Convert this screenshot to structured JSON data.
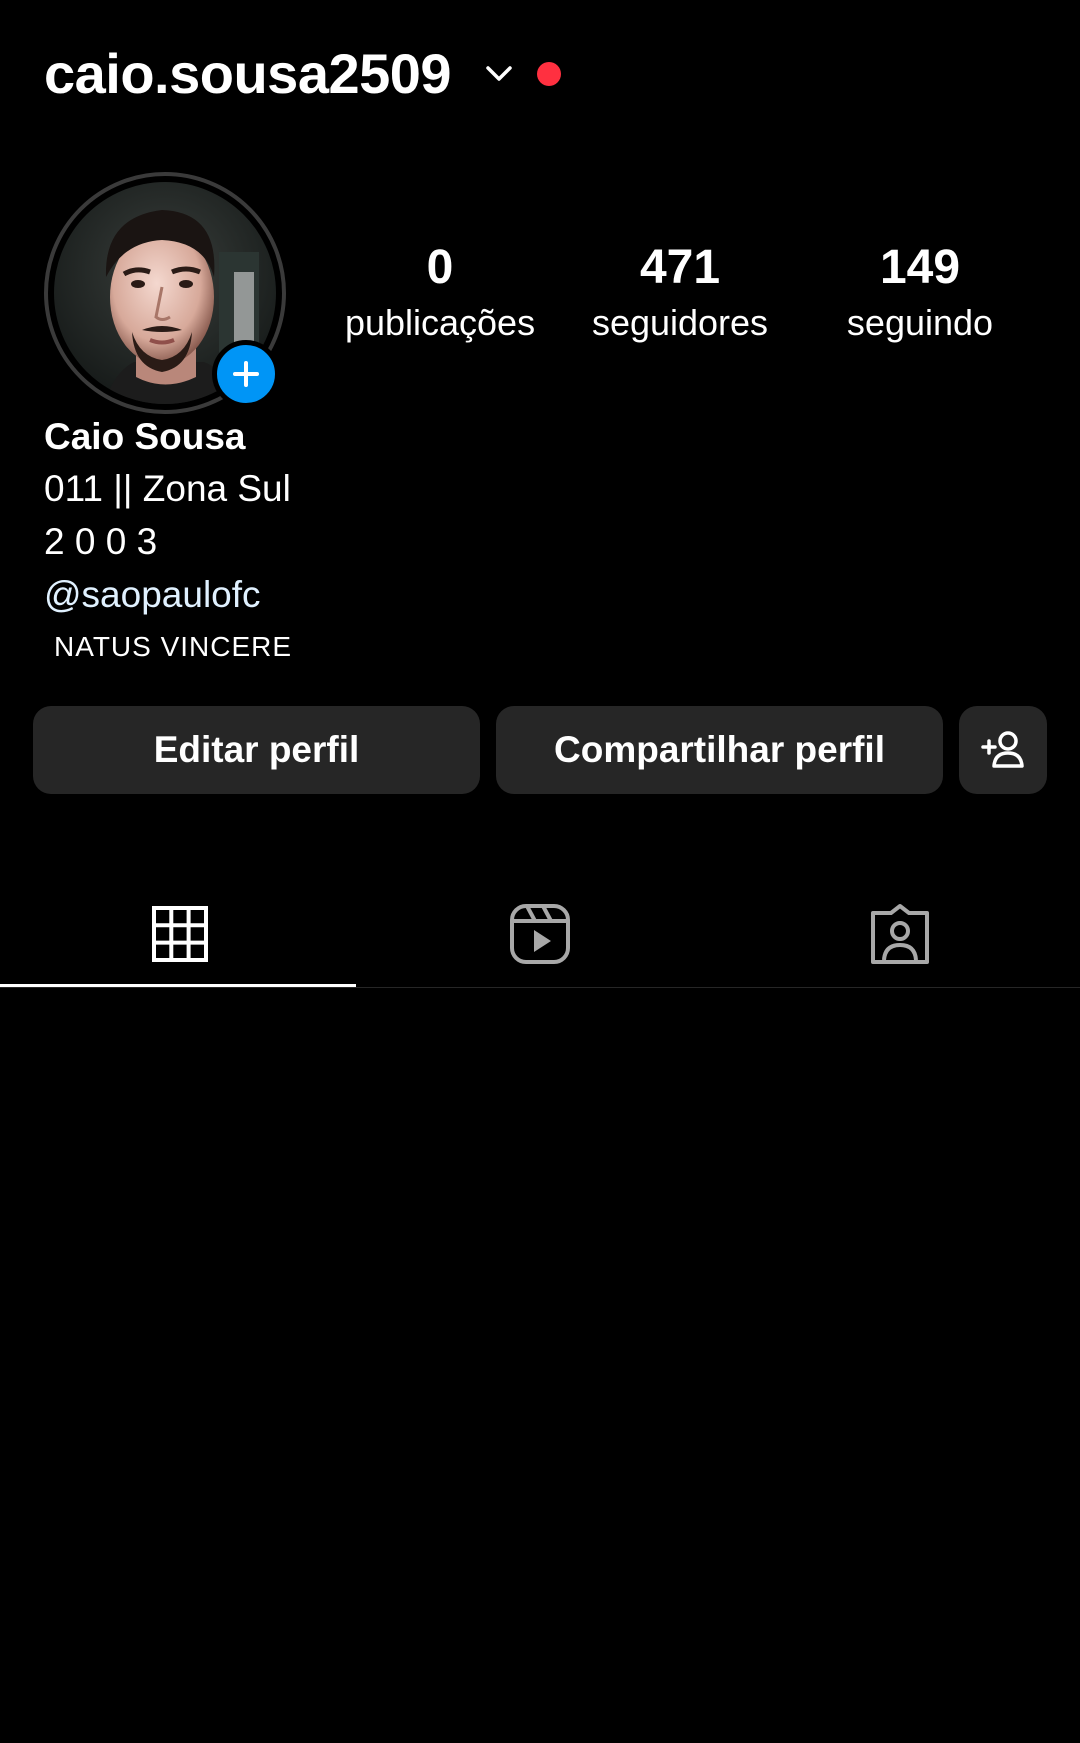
{
  "profile": {
    "username": "caio.sousa2509",
    "notification_color": "#ff3040",
    "story_add_color": "#0095f6"
  },
  "stats": [
    {
      "value": "0",
      "label": "publicações"
    },
    {
      "value": "471",
      "label": "seguidores"
    },
    {
      "value": "149",
      "label": "seguindo"
    }
  ],
  "bio": {
    "name": "Caio Sousa",
    "line1": "011 || Zona Sul",
    "line2": "2 0 0 3",
    "mention": "@saopaulofc",
    "tagline": "NATUS VINCERE"
  },
  "buttons": {
    "edit": "Editar perfil",
    "share": "Compartilhar perfil",
    "discover_icon": "add-person-icon"
  },
  "tabs": [
    {
      "icon": "grid-icon",
      "active": true
    },
    {
      "icon": "reels-icon",
      "active": false
    },
    {
      "icon": "tagged-icon",
      "active": false
    }
  ]
}
